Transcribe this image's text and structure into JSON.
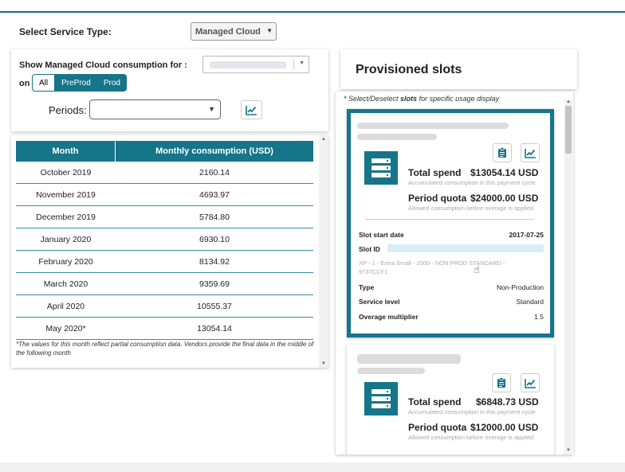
{
  "service": {
    "label": "Select Service Type:",
    "selected": "Managed Cloud"
  },
  "filters": {
    "show_label": "Show Managed Cloud consumption for :",
    "on_label": "on",
    "env_options": [
      "All",
      "PreProd",
      "Prod"
    ],
    "selected_env": "All",
    "periods_label": "Periods:",
    "periods_value": ""
  },
  "table": {
    "columns": [
      "Month",
      "Monthly consumption (USD)"
    ],
    "rows": [
      {
        "month": "October 2019",
        "value": "2160.14"
      },
      {
        "month": "November 2019",
        "value": "4693.97"
      },
      {
        "month": "December 2019",
        "value": "5784.80"
      },
      {
        "month": "January 2020",
        "value": "6930.10"
      },
      {
        "month": "February 2020",
        "value": "8134.92"
      },
      {
        "month": "March 2020",
        "value": "9359.69"
      },
      {
        "month": "April 2020",
        "value": "10555.37"
      },
      {
        "month": "May 2020*",
        "value": "13054.14"
      }
    ],
    "footnote": "*The values for this month reflect partial consumption data. Vendors provide the final data in the middle of the following month"
  },
  "slots": {
    "title": "Provisioned slots",
    "select_note_prefix": "* Select/Deselect ",
    "select_note_bold": "slots",
    "select_note_suffix": " for specific usage display",
    "cards": [
      {
        "total_spend_label": "Total spend",
        "total_spend_value": "$13054.14 USD",
        "total_spend_sub": "Accumulated consumption in this payment cycle",
        "quota_label": "Period quota",
        "quota_value": "$24000.00 USD",
        "quota_sub": "Allowed consumption before overage is applied",
        "start_date_label": "Slot start date",
        "start_date_value": "2017-07-25",
        "slot_id_label": "Slot ID",
        "slot_desc": "XP - 1 - Extra Small - 2000 - NON PROD STANDARD - 9737CCF1",
        "type_label": "Type",
        "type_value": "Non-Production",
        "service_level_label": "Service level",
        "service_level_value": "Standard",
        "overage_label": "Overage multiplier",
        "overage_value": "1.5"
      },
      {
        "total_spend_label": "Total spend",
        "total_spend_value": "$6848.73 USD",
        "total_spend_sub": "Accumulated consumption in this payment cycle",
        "quota_label": "Period quota",
        "quota_value": "$12000.00 USD",
        "quota_sub": "Allowed consumption before overage is applied"
      }
    ]
  },
  "icons": {
    "chart": "trend-chart-icon",
    "clipboard": "clipboard-icon",
    "server": "server-icon",
    "cursor": "hand-cursor-icon"
  },
  "colors": {
    "accent": "#157589",
    "top_line": "#1f6f80"
  }
}
